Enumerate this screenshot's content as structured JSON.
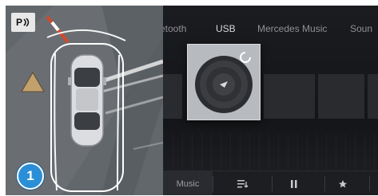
{
  "camera": {
    "park_button_label": "P",
    "badge_number": "1"
  },
  "media": {
    "tabs": [
      "etooth",
      "USB",
      "Mercedes Music",
      "Soun"
    ],
    "active_tab_index": 1,
    "bottom_bar": {
      "music_label": "Music",
      "icons": [
        "playlist-icon",
        "pause-icon",
        "star-icon"
      ]
    }
  },
  "colors": {
    "badge": "#2a8fd6",
    "camera_ground": "#5f6468",
    "media_background": "#141518"
  }
}
